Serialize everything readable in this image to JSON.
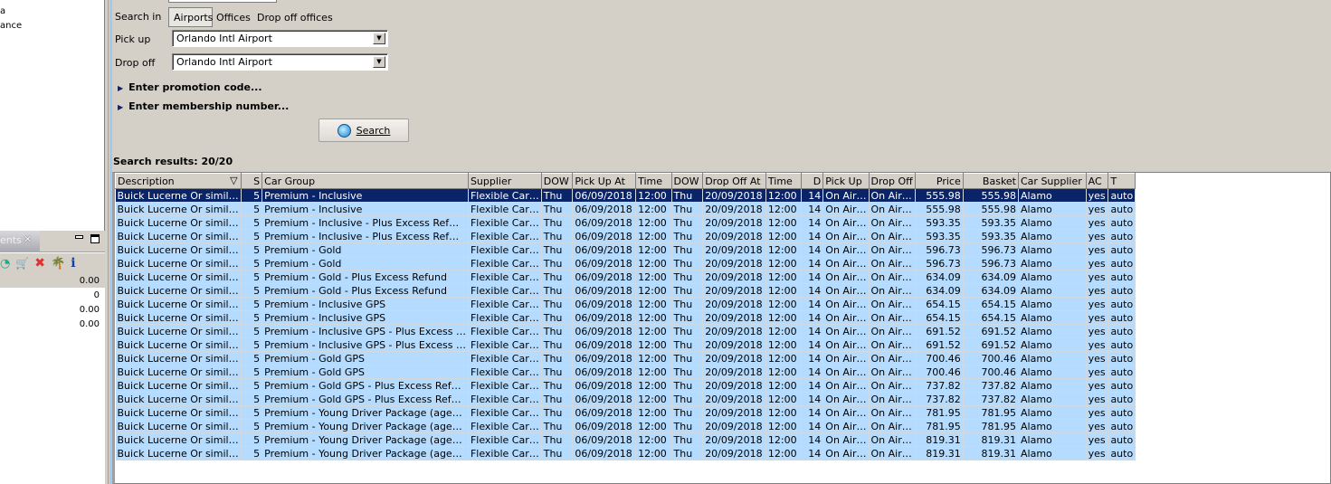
{
  "left_panel": {
    "tree_items": [
      "a",
      "ance"
    ],
    "tab_label": "ents",
    "values": [
      "0.00",
      "0",
      "0.00",
      "0.00"
    ]
  },
  "search": {
    "search_in_label": "Search in",
    "search_in_options": [
      "Airports",
      "Offices",
      "Drop off offices"
    ],
    "pickup_label": "Pick up",
    "pickup_value": "Orlando Intl Airport",
    "dropoff_label": "Drop off",
    "dropoff_value": "Orlando Intl Airport",
    "promo_label": "Enter promotion code...",
    "membership_label": "Enter membership number...",
    "search_button": "Search"
  },
  "results": {
    "title": "Search results: 20/20",
    "columns": [
      "Description",
      "S",
      "Car Group",
      "Supplier",
      "DOW",
      "Pick Up At",
      "Time",
      "DOW",
      "Drop Off At",
      "Time",
      "D",
      "Pick Up",
      "Drop Off",
      "Price",
      "Basket",
      "Car Supplier",
      "AC",
      "T"
    ],
    "rows": [
      [
        "Buick Lucerne Or simil…",
        "5",
        "Premium - Inclusive",
        "Flexible Car…",
        "Thu",
        "06/09/2018",
        "12:00",
        "Thu",
        "20/09/2018",
        "12:00",
        "14",
        "On Air…",
        "On Air…",
        "555.98",
        "555.98",
        "Alamo",
        "yes",
        "auto"
      ],
      [
        "Buick Lucerne Or simil…",
        "5",
        "Premium - Inclusive",
        "Flexible Car…",
        "Thu",
        "06/09/2018",
        "12:00",
        "Thu",
        "20/09/2018",
        "12:00",
        "14",
        "On Air…",
        "On Air…",
        "555.98",
        "555.98",
        "Alamo",
        "yes",
        "auto"
      ],
      [
        "Buick Lucerne Or simil…",
        "5",
        "Premium - Inclusive - Plus Excess Ref…",
        "Flexible Car…",
        "Thu",
        "06/09/2018",
        "12:00",
        "Thu",
        "20/09/2018",
        "12:00",
        "14",
        "On Air…",
        "On Air…",
        "593.35",
        "593.35",
        "Alamo",
        "yes",
        "auto"
      ],
      [
        "Buick Lucerne Or simil…",
        "5",
        "Premium - Inclusive - Plus Excess Ref…",
        "Flexible Car…",
        "Thu",
        "06/09/2018",
        "12:00",
        "Thu",
        "20/09/2018",
        "12:00",
        "14",
        "On Air…",
        "On Air…",
        "593.35",
        "593.35",
        "Alamo",
        "yes",
        "auto"
      ],
      [
        "Buick Lucerne Or simil…",
        "5",
        "Premium - Gold",
        "Flexible Car…",
        "Thu",
        "06/09/2018",
        "12:00",
        "Thu",
        "20/09/2018",
        "12:00",
        "14",
        "On Air…",
        "On Air…",
        "596.73",
        "596.73",
        "Alamo",
        "yes",
        "auto"
      ],
      [
        "Buick Lucerne Or simil…",
        "5",
        "Premium - Gold",
        "Flexible Car…",
        "Thu",
        "06/09/2018",
        "12:00",
        "Thu",
        "20/09/2018",
        "12:00",
        "14",
        "On Air…",
        "On Air…",
        "596.73",
        "596.73",
        "Alamo",
        "yes",
        "auto"
      ],
      [
        "Buick Lucerne Or simil…",
        "5",
        "Premium - Gold - Plus Excess Refund",
        "Flexible Car…",
        "Thu",
        "06/09/2018",
        "12:00",
        "Thu",
        "20/09/2018",
        "12:00",
        "14",
        "On Air…",
        "On Air…",
        "634.09",
        "634.09",
        "Alamo",
        "yes",
        "auto"
      ],
      [
        "Buick Lucerne Or simil…",
        "5",
        "Premium - Gold - Plus Excess Refund",
        "Flexible Car…",
        "Thu",
        "06/09/2018",
        "12:00",
        "Thu",
        "20/09/2018",
        "12:00",
        "14",
        "On Air…",
        "On Air…",
        "634.09",
        "634.09",
        "Alamo",
        "yes",
        "auto"
      ],
      [
        "Buick Lucerne Or simil…",
        "5",
        "Premium - Inclusive GPS",
        "Flexible Car…",
        "Thu",
        "06/09/2018",
        "12:00",
        "Thu",
        "20/09/2018",
        "12:00",
        "14",
        "On Air…",
        "On Air…",
        "654.15",
        "654.15",
        "Alamo",
        "yes",
        "auto"
      ],
      [
        "Buick Lucerne Or simil…",
        "5",
        "Premium - Inclusive GPS",
        "Flexible Car…",
        "Thu",
        "06/09/2018",
        "12:00",
        "Thu",
        "20/09/2018",
        "12:00",
        "14",
        "On Air…",
        "On Air…",
        "654.15",
        "654.15",
        "Alamo",
        "yes",
        "auto"
      ],
      [
        "Buick Lucerne Or simil…",
        "5",
        "Premium - Inclusive GPS - Plus Excess …",
        "Flexible Car…",
        "Thu",
        "06/09/2018",
        "12:00",
        "Thu",
        "20/09/2018",
        "12:00",
        "14",
        "On Air…",
        "On Air…",
        "691.52",
        "691.52",
        "Alamo",
        "yes",
        "auto"
      ],
      [
        "Buick Lucerne Or simil…",
        "5",
        "Premium - Inclusive GPS - Plus Excess …",
        "Flexible Car…",
        "Thu",
        "06/09/2018",
        "12:00",
        "Thu",
        "20/09/2018",
        "12:00",
        "14",
        "On Air…",
        "On Air…",
        "691.52",
        "691.52",
        "Alamo",
        "yes",
        "auto"
      ],
      [
        "Buick Lucerne Or simil…",
        "5",
        "Premium - Gold GPS",
        "Flexible Car…",
        "Thu",
        "06/09/2018",
        "12:00",
        "Thu",
        "20/09/2018",
        "12:00",
        "14",
        "On Air…",
        "On Air…",
        "700.46",
        "700.46",
        "Alamo",
        "yes",
        "auto"
      ],
      [
        "Buick Lucerne Or simil…",
        "5",
        "Premium - Gold GPS",
        "Flexible Car…",
        "Thu",
        "06/09/2018",
        "12:00",
        "Thu",
        "20/09/2018",
        "12:00",
        "14",
        "On Air…",
        "On Air…",
        "700.46",
        "700.46",
        "Alamo",
        "yes",
        "auto"
      ],
      [
        "Buick Lucerne Or simil…",
        "5",
        "Premium - Gold GPS - Plus Excess Ref…",
        "Flexible Car…",
        "Thu",
        "06/09/2018",
        "12:00",
        "Thu",
        "20/09/2018",
        "12:00",
        "14",
        "On Air…",
        "On Air…",
        "737.82",
        "737.82",
        "Alamo",
        "yes",
        "auto"
      ],
      [
        "Buick Lucerne Or simil…",
        "5",
        "Premium - Gold GPS - Plus Excess Ref…",
        "Flexible Car…",
        "Thu",
        "06/09/2018",
        "12:00",
        "Thu",
        "20/09/2018",
        "12:00",
        "14",
        "On Air…",
        "On Air…",
        "737.82",
        "737.82",
        "Alamo",
        "yes",
        "auto"
      ],
      [
        "Buick Lucerne Or simil…",
        "5",
        "Premium - Young Driver Package (age…",
        "Flexible Car…",
        "Thu",
        "06/09/2018",
        "12:00",
        "Thu",
        "20/09/2018",
        "12:00",
        "14",
        "On Air…",
        "On Air…",
        "781.95",
        "781.95",
        "Alamo",
        "yes",
        "auto"
      ],
      [
        "Buick Lucerne Or simil…",
        "5",
        "Premium - Young Driver Package (age…",
        "Flexible Car…",
        "Thu",
        "06/09/2018",
        "12:00",
        "Thu",
        "20/09/2018",
        "12:00",
        "14",
        "On Air…",
        "On Air…",
        "781.95",
        "781.95",
        "Alamo",
        "yes",
        "auto"
      ],
      [
        "Buick Lucerne Or simil…",
        "5",
        "Premium - Young Driver Package (age…",
        "Flexible Car…",
        "Thu",
        "06/09/2018",
        "12:00",
        "Thu",
        "20/09/2018",
        "12:00",
        "14",
        "On Air…",
        "On Air…",
        "819.31",
        "819.31",
        "Alamo",
        "yes",
        "auto"
      ],
      [
        "Buick Lucerne Or simil…",
        "5",
        "Premium - Young Driver Package (age…",
        "Flexible Car…",
        "Thu",
        "06/09/2018",
        "12:00",
        "Thu",
        "20/09/2018",
        "12:00",
        "14",
        "On Air…",
        "On Air…",
        "819.31",
        "819.31",
        "Alamo",
        "yes",
        "auto"
      ]
    ]
  }
}
